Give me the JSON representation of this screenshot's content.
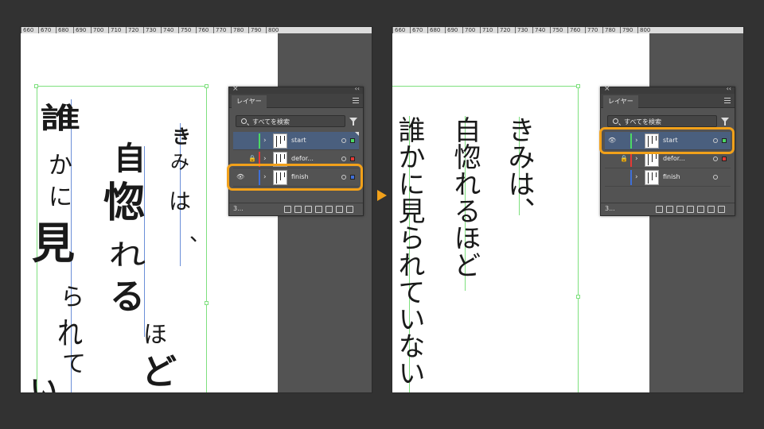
{
  "ruler": {
    "ticks": [
      "660",
      "670",
      "680",
      "690",
      "700",
      "710",
      "720",
      "730",
      "740",
      "750",
      "760",
      "770",
      "780",
      "790",
      "800"
    ]
  },
  "panel": {
    "tab_label": "レイヤー",
    "search_placeholder": "すべてを検索",
    "count": "3...",
    "layers": [
      {
        "name": "start",
        "color": "#4cd964",
        "swatch": "#4cd964"
      },
      {
        "name": "defor...",
        "color": "#e53935",
        "swatch": "#e53935"
      },
      {
        "name": "finish",
        "color": "#3f6fd8",
        "swatch": "#3f6fd8"
      }
    ]
  },
  "left_panel": {
    "selected_layer": "start",
    "highlighted_layer": "finish"
  },
  "right_panel": {
    "selected_layer": "start",
    "highlighted_layer": "start"
  },
  "text": {
    "col1": "きみは、",
    "col2": "自惚れるほど",
    "col3": "誰かに見られていない"
  },
  "deformed": {
    "c1": "誰",
    "c2": "か",
    "c3": "に",
    "c4": "見",
    "c5": "ら",
    "c6": "れ",
    "c7": "て",
    "c8": "い",
    "d1": "自",
    "d2": "惚",
    "d3": "れ",
    "d4": "る",
    "d5": "ほ",
    "d6": "ど",
    "e1": "き",
    "e2": "み",
    "e3": "は",
    "e4": "、"
  },
  "colors": {
    "accent": "#f2a11a",
    "guide": "#7ee07e",
    "selection": "#4a5f7e"
  }
}
